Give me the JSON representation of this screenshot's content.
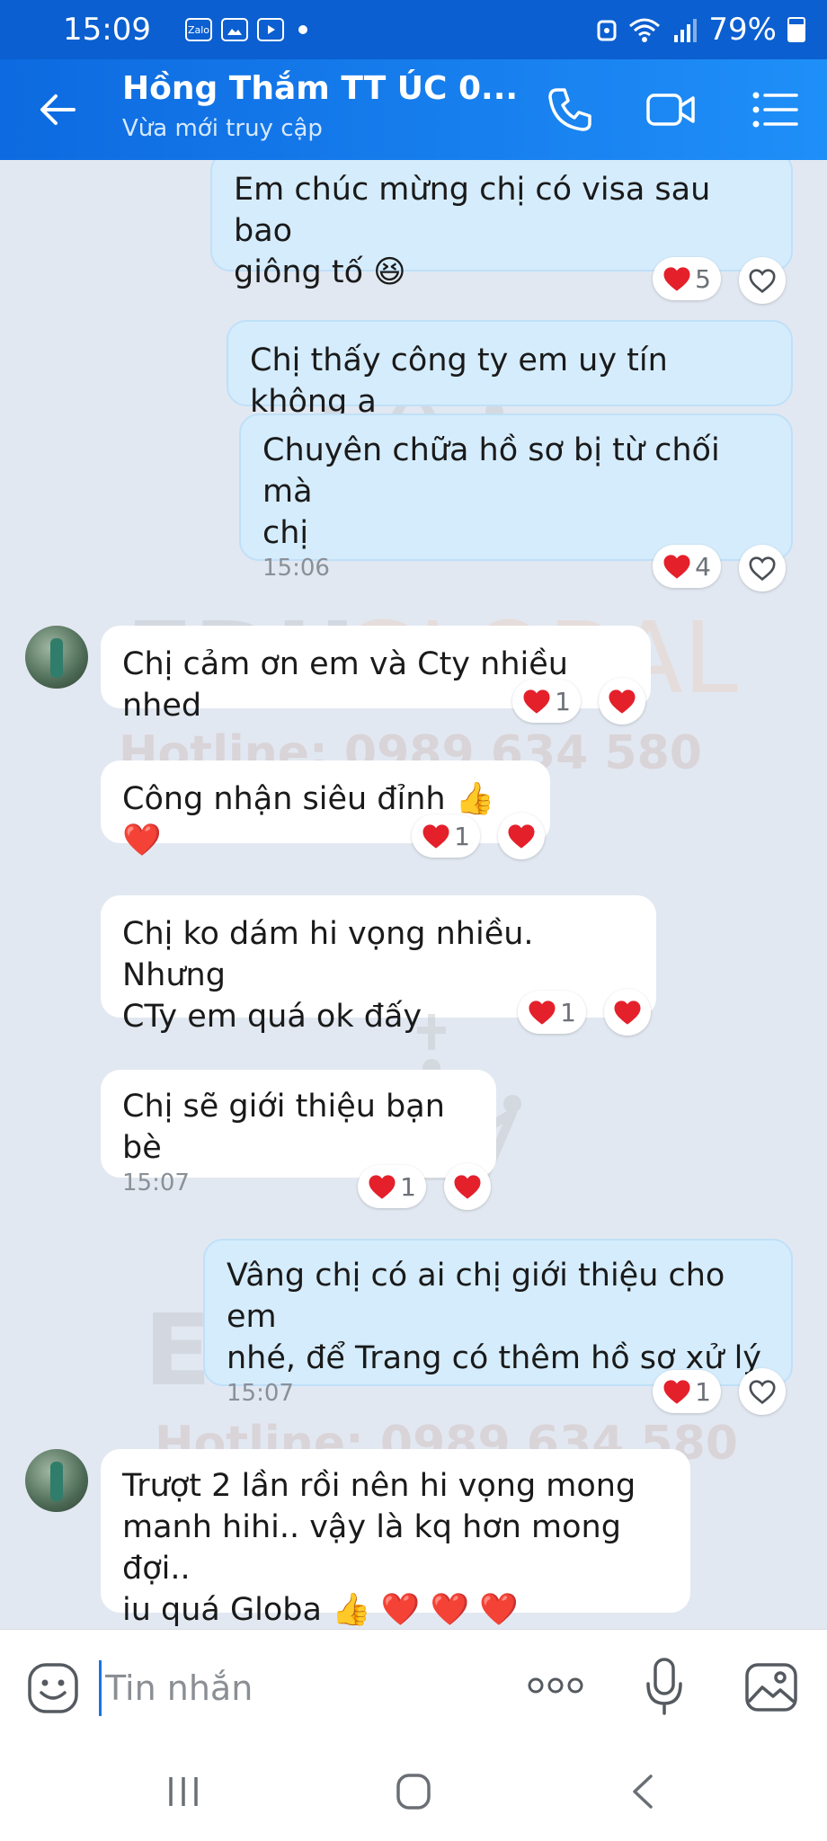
{
  "status_bar": {
    "time": "15:09",
    "app_icons": [
      "Zalo",
      "gallery-icon",
      "youtube-icon",
      "dot-icon"
    ],
    "battery": "79%"
  },
  "header": {
    "title": "Hồng Thắm TT ÚC  0...",
    "subtitle": "Vừa mới truy cập"
  },
  "watermark": {
    "brand_a": "EDU",
    "brand_b": "GLOBAL",
    "hotline": "Hotline: 0989 634 580"
  },
  "messages": [
    {
      "lines": [
        "Em chúc mừng chị có visa sau bao",
        "giông tố 😆"
      ],
      "reaction_count": "5"
    },
    {
      "lines": [
        "Chị thấy công ty em uy tín không ạ"
      ]
    },
    {
      "lines": [
        "Chuyên chữa hồ sơ bị từ chối mà",
        "chị"
      ],
      "time": "15:06",
      "reaction_count": "4"
    },
    {
      "lines": [
        "Chị cảm ơn em và Cty nhiều nhed"
      ],
      "reaction_count": "1"
    },
    {
      "lines": [
        "Công nhận siêu đỉnh 👍 ❤️"
      ],
      "reaction_count": "1"
    },
    {
      "lines": [
        "Chị ko dám hi vọng nhiều. Nhưng",
        "CTy em quá ok đấy"
      ],
      "reaction_count": "1"
    },
    {
      "lines": [
        "Chị sẽ giới thiệu bạn bè"
      ],
      "time": "15:07",
      "reaction_count": "1"
    },
    {
      "lines": [
        "Vâng chị có ai chị giới thiệu cho em",
        "nhé, để Trang có thêm hồ sơ xử lý"
      ],
      "time": "15:07",
      "reaction_count": "1"
    },
    {
      "lines": [
        "Trượt 2 lần rồi nên hi vọng mong",
        "manh hihi.. vậy là kq hơn mong đợi..",
        "iu quá Globa 👍 ❤️ ❤️ ❤️"
      ]
    }
  ],
  "input": {
    "placeholder": "Tin nhắn"
  },
  "colors": {
    "header": "#1585f0",
    "status_bar": "#0b5fd0",
    "outgoing_bubble": "#d5ecfc",
    "incoming_bubble": "#ffffff",
    "heart": "#e4202b",
    "background": "#e2e8f1"
  }
}
